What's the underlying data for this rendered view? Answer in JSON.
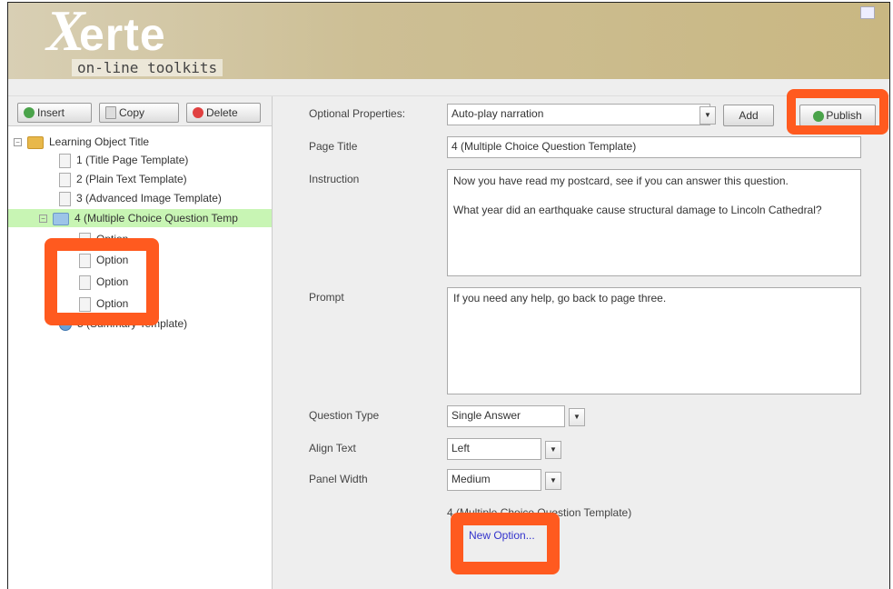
{
  "header": {
    "logo_x": "X",
    "logo_word": "erte",
    "logo_sub": "on-line toolkits"
  },
  "toolbar": {
    "insert_label": "Insert",
    "copy_label": "Copy",
    "delete_label": "Delete"
  },
  "tree": {
    "root_label": "Learning Object Title",
    "items": [
      {
        "label": "1 (Title Page Template)"
      },
      {
        "label": "2 (Plain Text Template)"
      },
      {
        "label": "3 (Advanced Image Template)"
      },
      {
        "label": "4 (Multiple Choice Question Temp"
      },
      {
        "label": "Option"
      },
      {
        "label": "Option"
      },
      {
        "label": "Option"
      },
      {
        "label": "Option"
      },
      {
        "label": "5 (Summary Template)"
      }
    ]
  },
  "properties": {
    "optional_label": "Optional Properties:",
    "optional_value": "Auto-play narration",
    "add_label": "Add",
    "publish_label": "Publish",
    "page_title_label": "Page Title",
    "page_title_value": "4 (Multiple Choice Question Template)",
    "instruction_label": "Instruction",
    "instruction_line1": "Now you have read my postcard, see if you can answer this question.",
    "instruction_line2": "What year did an earthquake cause structural damage to Lincoln Cathedral?",
    "prompt_label": "Prompt",
    "prompt_value": "If you need any help, go back to page three.",
    "question_type_label": "Question Type",
    "question_type_value": "Single Answer",
    "align_text_label": "Align Text",
    "align_text_value": "Left",
    "panel_width_label": "Panel Width",
    "panel_width_value": "Medium",
    "page_ref": "4 (Multiple Choice Question Template)",
    "new_option_link": "New Option..."
  },
  "colors": {
    "highlight": "#ff5a1f",
    "selected_row": "#c8f5b4",
    "link": "#3333cc"
  }
}
